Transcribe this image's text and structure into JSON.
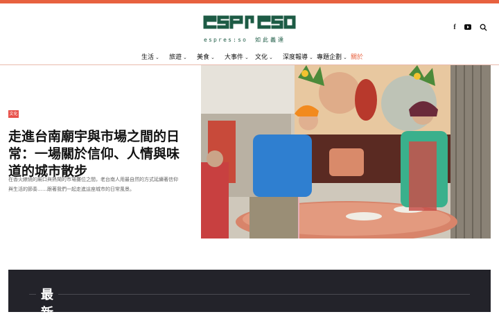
{
  "brand": {
    "logo_text": "espresso",
    "tagline": "espres:so",
    "tagline_cn": "如此義達",
    "color": "#1d5b45",
    "accent": "#e7613f"
  },
  "header": {
    "social": [
      {
        "name": "facebook-icon",
        "glyph": "f"
      },
      {
        "name": "youtube-icon"
      }
    ],
    "search_icon": "search-icon"
  },
  "nav": {
    "items": [
      {
        "label": "生活",
        "has_dropdown": true
      },
      {
        "label": "旅遊",
        "has_dropdown": true
      },
      {
        "label": "美食",
        "has_dropdown": true
      },
      {
        "label": "大事件",
        "has_dropdown": true
      },
      {
        "label": "文化",
        "has_dropdown": true
      },
      {
        "label": "深度報導",
        "has_dropdown": true
      },
      {
        "label": "專題企劃",
        "has_dropdown": true
      },
      {
        "label": "關於",
        "has_dropdown": false,
        "active": true
      }
    ]
  },
  "featured": {
    "category": "文化",
    "title": "走進台南廟宇與市場之間的日常：一場關於信仰、人情與味道的城市散步",
    "excerpt": "在香火繚繞的廟口與熱鬧的市場攤位之間，老台南人用最自然的方式延續著信仰與生活的節奏……跟著我們一起走進這座城市的日常風景。",
    "image_alt": "temple-market-photo"
  },
  "section": {
    "title": "最新"
  }
}
